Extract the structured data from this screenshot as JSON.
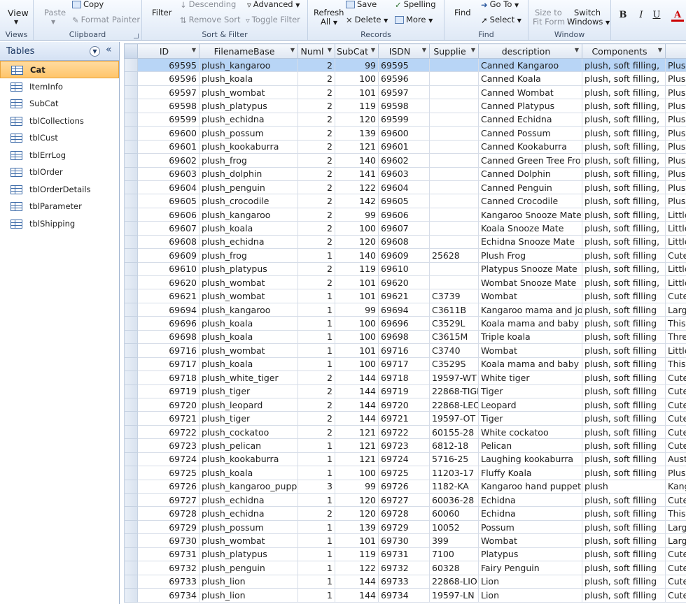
{
  "ribbon": {
    "views": {
      "view_label": "View",
      "group": "Views"
    },
    "clipboard": {
      "paste": "Paste",
      "copy": "Copy",
      "format_painter": "Format Painter",
      "group": "Clipboard"
    },
    "sort_filter": {
      "filter": "Filter",
      "descending": "Descending",
      "remove_sort": "Remove Sort",
      "advanced": "Advanced",
      "toggle_filter": "Toggle Filter",
      "group": "Sort & Filter"
    },
    "records": {
      "refresh": "Refresh",
      "refresh_all": "All",
      "save": "Save",
      "delete": "Delete",
      "spelling": "Spelling",
      "more": "More",
      "group": "Records"
    },
    "find": {
      "find": "Find",
      "goto": "Go To",
      "select": "Select",
      "group": "Find"
    },
    "window": {
      "size_to": "Size to",
      "fit_form": "Fit Form",
      "switch": "Switch",
      "windows": "Windows",
      "group": "Window"
    },
    "text_format": {
      "bold": "B",
      "italic": "I",
      "underline": "U",
      "font_color": "A"
    }
  },
  "nav": {
    "title": "Tables",
    "dropdown_icon": "chevron-down-icon",
    "collapse_icon": "double-chevron-left-icon",
    "items": [
      {
        "label": "Cat",
        "selected": true
      },
      {
        "label": "ItemInfo"
      },
      {
        "label": "SubCat"
      },
      {
        "label": "tblCollections"
      },
      {
        "label": "tblCust"
      },
      {
        "label": "tblErrLog"
      },
      {
        "label": "tblOrder"
      },
      {
        "label": "tblOrderDetails"
      },
      {
        "label": "tblParameter"
      },
      {
        "label": "tblShipping"
      }
    ]
  },
  "grid": {
    "columns": [
      "ID",
      "FilenameBase",
      "Numl",
      "SubCat",
      "ISDN",
      "Supplie",
      "description",
      "Components",
      ""
    ],
    "rows": [
      [
        "69595",
        "plush_kangaroo",
        "2",
        "99",
        "69595",
        "",
        "Canned Kangaroo",
        "plush, soft filling,",
        "Plush"
      ],
      [
        "69596",
        "plush_koala",
        "2",
        "100",
        "69596",
        "",
        "Canned Koala",
        "plush, soft filling,",
        "Plush"
      ],
      [
        "69597",
        "plush_wombat",
        "2",
        "101",
        "69597",
        "",
        "Canned Wombat",
        "plush, soft filling,",
        "Plush"
      ],
      [
        "69598",
        "plush_platypus",
        "2",
        "119",
        "69598",
        "",
        "Canned Platypus",
        "plush, soft filling,",
        "Plush"
      ],
      [
        "69599",
        "plush_echidna",
        "2",
        "120",
        "69599",
        "",
        "Canned Echidna",
        "plush, soft filling,",
        "Plush"
      ],
      [
        "69600",
        "plush_possum",
        "2",
        "139",
        "69600",
        "",
        "Canned Possum",
        "plush, soft filling,",
        "Plush"
      ],
      [
        "69601",
        "plush_kookaburra",
        "2",
        "121",
        "69601",
        "",
        "Canned Kookaburra",
        "plush, soft filling,",
        "Plush"
      ],
      [
        "69602",
        "plush_frog",
        "2",
        "140",
        "69602",
        "",
        "Canned Green Tree Fro",
        "plush, soft filling,",
        "Plush"
      ],
      [
        "69603",
        "plush_dolphin",
        "2",
        "141",
        "69603",
        "",
        "Canned Dolphin",
        "plush, soft filling,",
        "Plush"
      ],
      [
        "69604",
        "plush_penguin",
        "2",
        "122",
        "69604",
        "",
        "Canned Penguin",
        "plush, soft filling,",
        "Plush"
      ],
      [
        "69605",
        "plush_crocodile",
        "2",
        "142",
        "69605",
        "",
        "Canned Crocodile",
        "plush, soft filling,",
        "Plush"
      ],
      [
        "69606",
        "plush_kangaroo",
        "2",
        "99",
        "69606",
        "",
        "Kangaroo Snooze Mate",
        "plush, soft filling,",
        "Little"
      ],
      [
        "69607",
        "plush_koala",
        "2",
        "100",
        "69607",
        "",
        "Koala Snooze Mate",
        "plush, soft filling,",
        "Little"
      ],
      [
        "69608",
        "plush_echidna",
        "2",
        "120",
        "69608",
        "",
        "Echidna Snooze Mate",
        "plush, soft filling,",
        "Little"
      ],
      [
        "69609",
        "plush_frog",
        "1",
        "140",
        "69609",
        "25628",
        "Plush Frog",
        "plush, soft filling",
        "Cute"
      ],
      [
        "69610",
        "plush_platypus",
        "2",
        "119",
        "69610",
        "",
        "Platypus Snooze Mate",
        "plush, soft filling,",
        "Little"
      ],
      [
        "69620",
        "plush_wombat",
        "2",
        "101",
        "69620",
        "",
        "Wombat Snooze Mate",
        "plush, soft filling,",
        "Little"
      ],
      [
        "69621",
        "plush_wombat",
        "1",
        "101",
        "69621",
        "C3739",
        "Wombat",
        "plush, soft filling",
        "Cute"
      ],
      [
        "69694",
        "plush_kangaroo",
        "1",
        "99",
        "69694",
        "C3611B",
        "Kangaroo mama and jo",
        "plush, soft filling",
        "Large"
      ],
      [
        "69696",
        "plush_koala",
        "1",
        "100",
        "69696",
        "C3529L",
        "Koala mama and baby",
        "plush, soft filling",
        "This"
      ],
      [
        "69698",
        "plush_koala",
        "1",
        "100",
        "69698",
        "C3615M",
        "Triple koala",
        "plush, soft filling",
        "Three"
      ],
      [
        "69716",
        "plush_wombat",
        "1",
        "101",
        "69716",
        "C3740",
        "Wombat",
        "plush, soft filling",
        "Little"
      ],
      [
        "69717",
        "plush_koala",
        "1",
        "100",
        "69717",
        "C3529S",
        "Koala mama and baby",
        "plush, soft filling",
        "This"
      ],
      [
        "69718",
        "plush_white_tiger",
        "2",
        "144",
        "69718",
        "19597-WT",
        "White tiger",
        "plush, soft filling",
        "Cute"
      ],
      [
        "69719",
        "plush_tiger",
        "2",
        "144",
        "69719",
        "22868-TIGE",
        "Tiger",
        "plush, soft filling",
        "Cute"
      ],
      [
        "69720",
        "plush_leopard",
        "2",
        "144",
        "69720",
        "22868-LEO",
        "Leopard",
        "plush, soft filling",
        "Cute"
      ],
      [
        "69721",
        "plush_tiger",
        "2",
        "144",
        "69721",
        "19597-OT",
        "Tiger",
        "plush, soft filling",
        "Cute"
      ],
      [
        "69722",
        "plush_cockatoo",
        "2",
        "121",
        "69722",
        "60155-28",
        "White cockatoo",
        "plush, soft filling",
        "Cute"
      ],
      [
        "69723",
        "plush_pelican",
        "1",
        "121",
        "69723",
        "6812-18",
        "Pelican",
        "plush, soft filling",
        "Cute"
      ],
      [
        "69724",
        "plush_kookaburra",
        "1",
        "121",
        "69724",
        "5716-25",
        "Laughing kookaburra",
        "plush, soft filling",
        "Aust"
      ],
      [
        "69725",
        "plush_koala",
        "1",
        "100",
        "69725",
        "11203-17",
        "Fluffy Koala",
        "plush, soft filling",
        "Plush"
      ],
      [
        "69726",
        "plush_kangaroo_pupp",
        "3",
        "99",
        "69726",
        "1182-KA",
        "Kangaroo hand puppet",
        "plush",
        "Kang"
      ],
      [
        "69727",
        "plush_echidna",
        "1",
        "120",
        "69727",
        "60036-28",
        "Echidna",
        "plush, soft filling",
        "Cute"
      ],
      [
        "69728",
        "plush_echidna",
        "2",
        "120",
        "69728",
        "60060",
        "Echidna",
        "plush, soft filling",
        "This"
      ],
      [
        "69729",
        "plush_possum",
        "1",
        "139",
        "69729",
        "10052",
        "Possum",
        "plush, soft filling",
        "Large"
      ],
      [
        "69730",
        "plush_wombat",
        "1",
        "101",
        "69730",
        "399",
        "Wombat",
        "plush, soft filling",
        "Large"
      ],
      [
        "69731",
        "plush_platypus",
        "1",
        "119",
        "69731",
        "7100",
        "Platypus",
        "plush, soft filling",
        "Cute"
      ],
      [
        "69732",
        "plush_penguin",
        "1",
        "122",
        "69732",
        "60328",
        "Fairy Penguin",
        "plush, soft filling",
        "Cute"
      ],
      [
        "69733",
        "plush_lion",
        "1",
        "144",
        "69733",
        "22868-LIOI",
        "Lion",
        "plush, soft filling",
        "Cute"
      ],
      [
        "69734",
        "plush_lion",
        "1",
        "144",
        "69734",
        "19597-LN",
        "Lion",
        "plush, soft filling",
        "Cute"
      ]
    ]
  }
}
